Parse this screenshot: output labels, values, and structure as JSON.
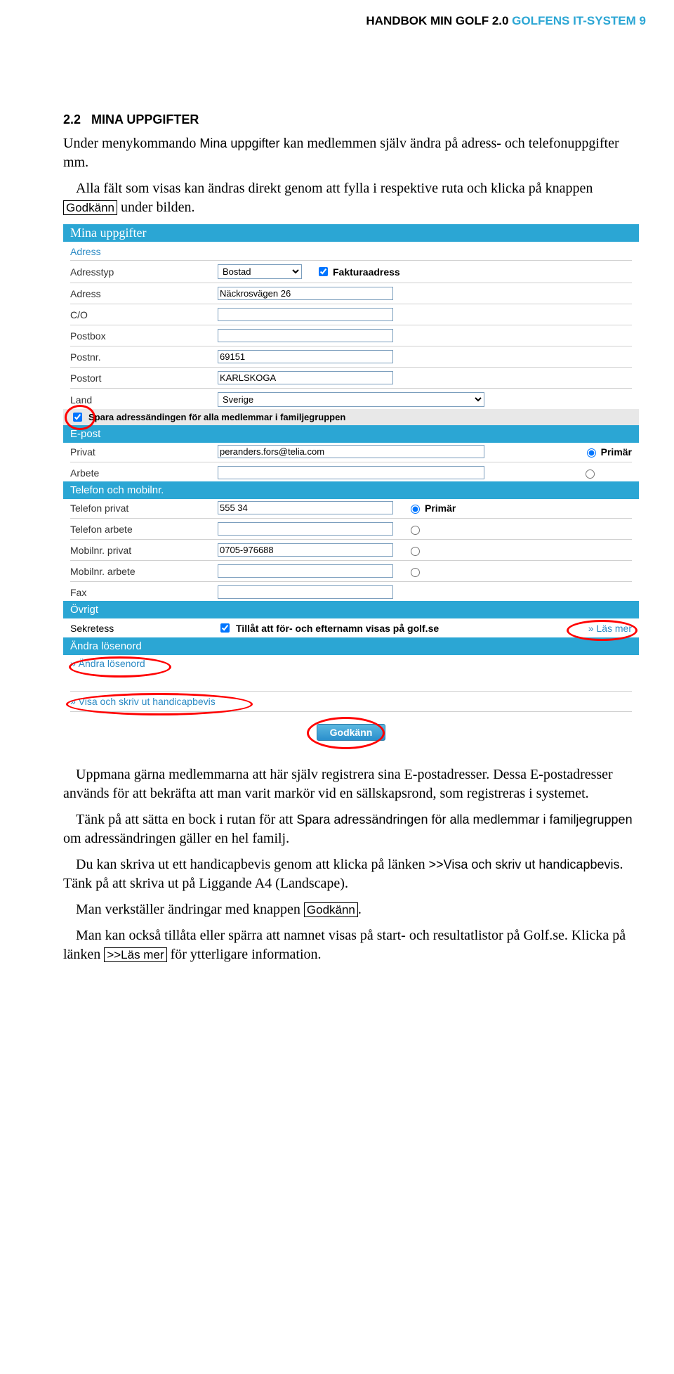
{
  "header": {
    "bold": "HANDBOK  MIN GOLF 2.0",
    "blue": " GOLFENS IT-SYSTEM ",
    "page": "9"
  },
  "section": {
    "number": "2.2",
    "title": "MINA UPPGIFTER"
  },
  "intro": {
    "p1a": "Under menykommando ",
    "p1_ui": "Mina uppgifter",
    "p1b": " kan medlemmen själv ändra på adress- och telefonuppgifter mm.",
    "p2a": "Alla fält som visas kan ändras direkt genom att fylla i respektive ruta och klicka på knappen ",
    "p2_btn": "Godkänn",
    "p2b": " under bilden."
  },
  "form": {
    "main_head": "Mina uppgifter",
    "adress_head": "Adress",
    "adresstyp_lbl": "Adresstyp",
    "adresstyp_val": "Bostad",
    "fakturaadress": "Fakturaadress",
    "adress_lbl": "Adress",
    "adress_val": "Näckrosvägen 26",
    "co_lbl": "C/O",
    "postbox_lbl": "Postbox",
    "postnr_lbl": "Postnr.",
    "postnr_val": "69151",
    "postort_lbl": "Postort",
    "postort_val": "KARLSKOGA",
    "land_lbl": "Land",
    "land_val": "Sverige",
    "spara_famil": "Spara adressändingen för alla medlemmar i familjegruppen",
    "epost_head": "E-post",
    "privat_lbl": "Privat",
    "privat_val": "peranders.fors@telia.com",
    "primar": "Primär",
    "arbete_lbl": "Arbete",
    "tel_head": "Telefon och mobilnr.",
    "tel_privat_lbl": "Telefon privat",
    "tel_privat_val": "555 34",
    "tel_arbete_lbl": "Telefon arbete",
    "mob_privat_lbl": "Mobilnr. privat",
    "mob_privat_val": "0705-976688",
    "mob_arbete_lbl": "Mobilnr. arbete",
    "fax_lbl": "Fax",
    "ovrigt_head": "Övrigt",
    "sekretess_lbl": "Sekretess",
    "tillat_lbl": "Tillåt att för- och efternamn visas på golf.se",
    "lasmer": "» Läs mer",
    "andra_losen_head": "Ändra lösenord",
    "andra_losen_link": "» Ändra lösenord",
    "visa_hcp": "» Visa och skriv ut handicapbevis",
    "godkann": "Godkänn"
  },
  "after": {
    "p1": "Uppmana gärna medlemmarna att här själv registrera sina E-postadresser. Dessa E-postadresser används för att bekräfta att man varit markör vid en sällskapsrond, som registreras i systemet.",
    "p2a": "Tänk på att sätta en bock i rutan för att ",
    "p2_ui": "Spara adressändringen för alla medlemmar i familjegruppen",
    "p2b": " om adressändringen gäller en hel familj.",
    "p3a": "Du kan skriva ut ett handicapbevis genom att klicka på länken ",
    "p3_ui": ">>Visa och skriv ut handicapbevis",
    "p3b": ". Tänk på att skriva ut på Liggande A4 (Landscape).",
    "p4a": "Man verkställer ändringar med knappen ",
    "p4_btn": "Godkänn",
    "p4b": ".",
    "p5a": "Man kan också tillåta eller spärra att namnet visas på start- och resultatlistor på Golf.se. Klicka på länken ",
    "p5_btn": ">>Läs mer",
    "p5b": " för ytterligare information."
  }
}
